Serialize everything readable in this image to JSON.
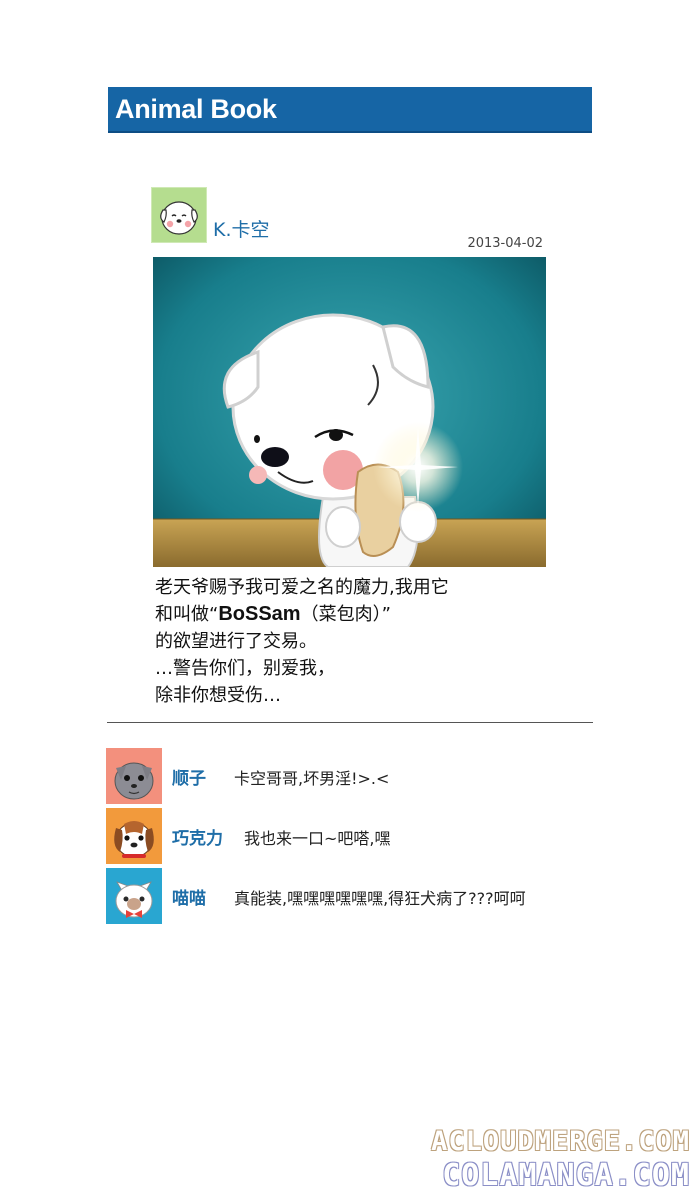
{
  "app": {
    "title": "Animal Book"
  },
  "post": {
    "author": "K.卡空",
    "date": "2013-04-02",
    "body": {
      "line1": "老天爷赐予我可爱之名的魔力,我用它",
      "line2_prefix": "和叫做“",
      "line2_emph": "BoSSam",
      "line2_suffix": "（菜包肉）”",
      "line3": "的欲望进行了交易。",
      "line4": "…警告你们，别爱我，",
      "line5": "除非你想受伤…"
    }
  },
  "comments": [
    {
      "name": "顺子",
      "text": "卡空哥哥,坏男淫!>.<",
      "avatar_icon": "gray-dog-avatar"
    },
    {
      "name": "巧克力",
      "text": "我也来一口~吧嗒,嘿",
      "avatar_icon": "beagle-avatar"
    },
    {
      "name": "喵喵",
      "text": "真能装,嘿嘿嘿嘿嘿嘿,得狂犬病了???呵呵",
      "avatar_icon": "cat-avatar"
    }
  ],
  "watermark": {
    "line1": "ACLOUDMERGE.COM",
    "line2": "COLAMANGA.COM"
  },
  "colors": {
    "header_bg": "#1665a5",
    "name_blue": "#1f6ea8",
    "avatar_green": "#b5dd8f",
    "avatar_salmon": "#f3907d",
    "avatar_orange": "#f29a3c",
    "avatar_cyan": "#29a6d1"
  }
}
